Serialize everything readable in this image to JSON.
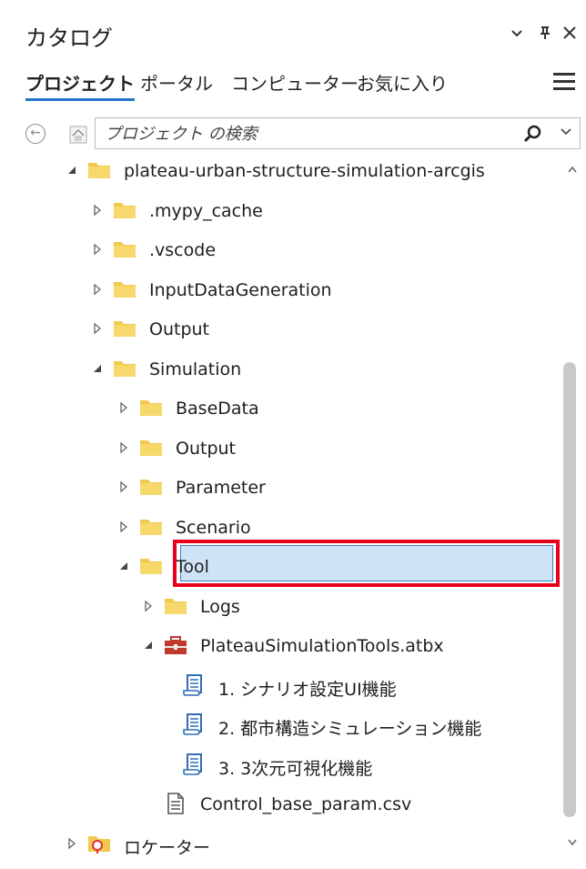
{
  "header": {
    "title": "カタログ",
    "chevron_glyph": "⌄",
    "pin_glyph": "ᛒ",
    "close_glyph": "✕"
  },
  "tabs": [
    {
      "label": "プロジェクト",
      "active": true
    },
    {
      "label": "ポータル",
      "active": false
    },
    {
      "label": "コンピューター",
      "active": false
    },
    {
      "label": "お気に入り",
      "active": false
    }
  ],
  "search": {
    "placeholder": "プロジェクト の検索",
    "value": ""
  },
  "tree": [
    {
      "label": "plateau-urban-structure-simulation-arcgis",
      "expander": "expanded",
      "icon": "folder-icon"
    },
    {
      "label": ".mypy_cache",
      "expander": "collapsed",
      "icon": "folder-icon"
    },
    {
      "label": ".vscode",
      "expander": "collapsed",
      "icon": "folder-icon"
    },
    {
      "label": "InputDataGeneration",
      "expander": "collapsed",
      "icon": "folder-icon"
    },
    {
      "label": "Output",
      "expander": "collapsed",
      "icon": "folder-icon"
    },
    {
      "label": "Simulation",
      "expander": "expanded",
      "icon": "folder-icon"
    },
    {
      "label": "BaseData",
      "expander": "collapsed",
      "icon": "folder-icon"
    },
    {
      "label": "Output",
      "expander": "collapsed",
      "icon": "folder-icon"
    },
    {
      "label": "Parameter",
      "expander": "collapsed",
      "icon": "folder-icon"
    },
    {
      "label": "Scenario",
      "expander": "collapsed",
      "icon": "folder-icon"
    },
    {
      "label": "Tool",
      "expander": "expanded",
      "icon": "folder-icon"
    },
    {
      "label": "Logs",
      "expander": "collapsed",
      "icon": "folder-icon"
    },
    {
      "label": "PlateauSimulationTools.atbx",
      "expander": "expanded",
      "icon": "toolbox-icon"
    },
    {
      "label": "1. シナリオ設定UI機能",
      "expander": "none",
      "icon": "script-tool-icon"
    },
    {
      "label": "2. 都市構造シミュレーション機能",
      "expander": "none",
      "icon": "script-tool-icon",
      "selected": true
    },
    {
      "label": "3. 3次元可視化機能",
      "expander": "none",
      "icon": "script-tool-icon"
    },
    {
      "label": "Control_base_param.csv",
      "expander": "none",
      "icon": "text-file-icon"
    },
    {
      "label": "ロケーター",
      "expander": "collapsed",
      "icon": "locator-folder-icon"
    }
  ],
  "colors": {
    "selection_bg": "#cfe3f6",
    "selection_border": "#3b7fc4",
    "highlight_outline": "#e8001c",
    "folder": "#f2c94c",
    "toolbox": "#c0392b",
    "script": "#2f6db5"
  }
}
